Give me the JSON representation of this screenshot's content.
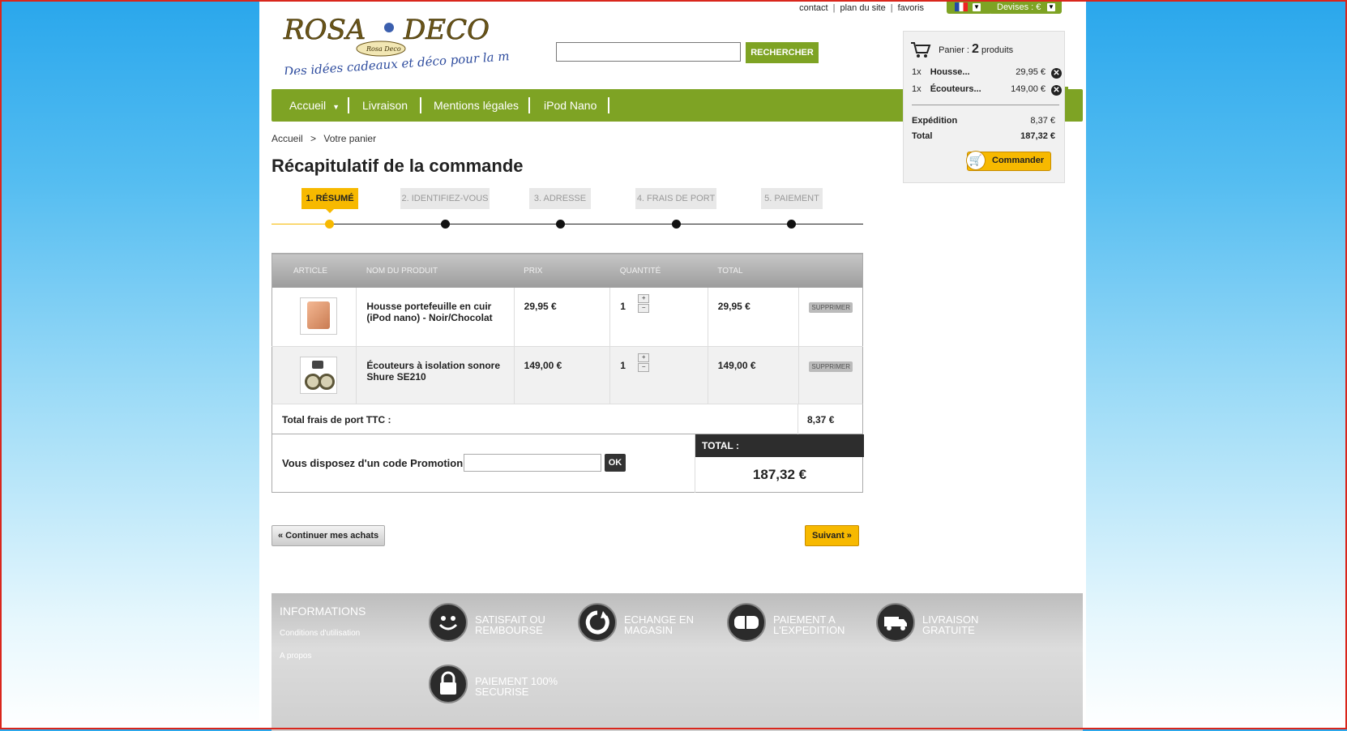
{
  "top_links": {
    "contact": "contact",
    "plan": "plan du site",
    "favoris": "favoris",
    "devises": "Devises : €"
  },
  "logo": {
    "brand": "ROSA DECO",
    "tagline": "Des idées cadeaux et déco pour la maison",
    "seal": "Rosa Deco"
  },
  "search": {
    "value": "",
    "button": "RECHERCHER"
  },
  "nav": [
    "Accueil",
    "Livraison",
    "Mentions légales",
    "iPod Nano"
  ],
  "cart_block": {
    "label": "Panier :",
    "count": "2",
    "unit": "produits",
    "items": [
      {
        "qty": "1x",
        "name": "Housse...",
        "price": "29,95 €"
      },
      {
        "qty": "1x",
        "name": "Écouteurs...",
        "price": "149,00 €"
      }
    ],
    "shipping_label": "Expédition",
    "shipping": "8,37 €",
    "total_label": "Total",
    "total": "187,32 €",
    "button": "Commander"
  },
  "breadcrumb": {
    "home": "Accueil",
    "sep": ">",
    "current": "Votre panier"
  },
  "page_title": "Récapitulatif de la commande",
  "steps": [
    "1. RÉSUMÉ",
    "2. IDENTIFIEZ-VOUS",
    "3. ADRESSE",
    "4. FRAIS DE PORT",
    "5. PAIEMENT"
  ],
  "table": {
    "headers": [
      "ARTICLE",
      "NOM DU PRODUIT",
      "PRIX",
      "QUANTITÉ",
      "TOTAL"
    ],
    "rows": [
      {
        "name": "Housse portefeuille en cuir (iPod nano) - Noir/Chocolat",
        "price": "29,95 €",
        "qty": "1",
        "total": "29,95 €",
        "remove": "SUPPRIMER"
      },
      {
        "name": "Écouteurs à isolation sonore Shure SE210",
        "price": "149,00 €",
        "qty": "1",
        "total": "149,00 €",
        "remove": "SUPPRIMER"
      }
    ],
    "shipping_label": "Total frais de port TTC :",
    "shipping": "8,37 €",
    "promo_label": "Vous disposez d'un code Promotion",
    "promo_value": "",
    "promo_button": "OK",
    "total_label": "TOTAL :",
    "total": "187,32 €"
  },
  "buttons": {
    "continue": "« Continuer mes achats",
    "next": "Suivant »"
  },
  "footer": {
    "info_title": "INFORMATIONS",
    "info_links": [
      "Conditions d'utilisation",
      "A propos"
    ],
    "features": [
      {
        "line1": "SATISFAIT OU",
        "line2": "REMBOURSE",
        "icon": "smiley-icon"
      },
      {
        "line1": "ECHANGE EN",
        "line2": "MAGASIN",
        "icon": "refresh-icon"
      },
      {
        "line1": "PAIEMENT A",
        "line2": "L'EXPEDITION",
        "icon": "card-icon"
      },
      {
        "line1": "LIVRAISON",
        "line2": "GRATUITE",
        "icon": "truck-icon"
      },
      {
        "line1": "PAIEMENT 100%",
        "line2": "SECURISE",
        "icon": "lock-icon"
      }
    ]
  },
  "colors": {
    "accent_green": "#7ea324",
    "accent_yellow": "#f7b900",
    "frame_red": "#d9261c"
  }
}
